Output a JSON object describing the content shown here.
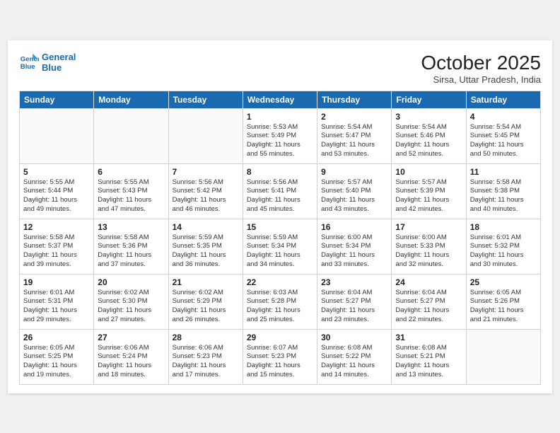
{
  "header": {
    "logo_line1": "General",
    "logo_line2": "Blue",
    "month_title": "October 2025",
    "location": "Sirsa, Uttar Pradesh, India"
  },
  "weekdays": [
    "Sunday",
    "Monday",
    "Tuesday",
    "Wednesday",
    "Thursday",
    "Friday",
    "Saturday"
  ],
  "weeks": [
    [
      {
        "day": "",
        "text": ""
      },
      {
        "day": "",
        "text": ""
      },
      {
        "day": "",
        "text": ""
      },
      {
        "day": "1",
        "text": "Sunrise: 5:53 AM\nSunset: 5:49 PM\nDaylight: 11 hours\nand 55 minutes."
      },
      {
        "day": "2",
        "text": "Sunrise: 5:54 AM\nSunset: 5:47 PM\nDaylight: 11 hours\nand 53 minutes."
      },
      {
        "day": "3",
        "text": "Sunrise: 5:54 AM\nSunset: 5:46 PM\nDaylight: 11 hours\nand 52 minutes."
      },
      {
        "day": "4",
        "text": "Sunrise: 5:54 AM\nSunset: 5:45 PM\nDaylight: 11 hours\nand 50 minutes."
      }
    ],
    [
      {
        "day": "5",
        "text": "Sunrise: 5:55 AM\nSunset: 5:44 PM\nDaylight: 11 hours\nand 49 minutes."
      },
      {
        "day": "6",
        "text": "Sunrise: 5:55 AM\nSunset: 5:43 PM\nDaylight: 11 hours\nand 47 minutes."
      },
      {
        "day": "7",
        "text": "Sunrise: 5:56 AM\nSunset: 5:42 PM\nDaylight: 11 hours\nand 46 minutes."
      },
      {
        "day": "8",
        "text": "Sunrise: 5:56 AM\nSunset: 5:41 PM\nDaylight: 11 hours\nand 45 minutes."
      },
      {
        "day": "9",
        "text": "Sunrise: 5:57 AM\nSunset: 5:40 PM\nDaylight: 11 hours\nand 43 minutes."
      },
      {
        "day": "10",
        "text": "Sunrise: 5:57 AM\nSunset: 5:39 PM\nDaylight: 11 hours\nand 42 minutes."
      },
      {
        "day": "11",
        "text": "Sunrise: 5:58 AM\nSunset: 5:38 PM\nDaylight: 11 hours\nand 40 minutes."
      }
    ],
    [
      {
        "day": "12",
        "text": "Sunrise: 5:58 AM\nSunset: 5:37 PM\nDaylight: 11 hours\nand 39 minutes."
      },
      {
        "day": "13",
        "text": "Sunrise: 5:58 AM\nSunset: 5:36 PM\nDaylight: 11 hours\nand 37 minutes."
      },
      {
        "day": "14",
        "text": "Sunrise: 5:59 AM\nSunset: 5:35 PM\nDaylight: 11 hours\nand 36 minutes."
      },
      {
        "day": "15",
        "text": "Sunrise: 5:59 AM\nSunset: 5:34 PM\nDaylight: 11 hours\nand 34 minutes."
      },
      {
        "day": "16",
        "text": "Sunrise: 6:00 AM\nSunset: 5:34 PM\nDaylight: 11 hours\nand 33 minutes."
      },
      {
        "day": "17",
        "text": "Sunrise: 6:00 AM\nSunset: 5:33 PM\nDaylight: 11 hours\nand 32 minutes."
      },
      {
        "day": "18",
        "text": "Sunrise: 6:01 AM\nSunset: 5:32 PM\nDaylight: 11 hours\nand 30 minutes."
      }
    ],
    [
      {
        "day": "19",
        "text": "Sunrise: 6:01 AM\nSunset: 5:31 PM\nDaylight: 11 hours\nand 29 minutes."
      },
      {
        "day": "20",
        "text": "Sunrise: 6:02 AM\nSunset: 5:30 PM\nDaylight: 11 hours\nand 27 minutes."
      },
      {
        "day": "21",
        "text": "Sunrise: 6:02 AM\nSunset: 5:29 PM\nDaylight: 11 hours\nand 26 minutes."
      },
      {
        "day": "22",
        "text": "Sunrise: 6:03 AM\nSunset: 5:28 PM\nDaylight: 11 hours\nand 25 minutes."
      },
      {
        "day": "23",
        "text": "Sunrise: 6:04 AM\nSunset: 5:27 PM\nDaylight: 11 hours\nand 23 minutes."
      },
      {
        "day": "24",
        "text": "Sunrise: 6:04 AM\nSunset: 5:27 PM\nDaylight: 11 hours\nand 22 minutes."
      },
      {
        "day": "25",
        "text": "Sunrise: 6:05 AM\nSunset: 5:26 PM\nDaylight: 11 hours\nand 21 minutes."
      }
    ],
    [
      {
        "day": "26",
        "text": "Sunrise: 6:05 AM\nSunset: 5:25 PM\nDaylight: 11 hours\nand 19 minutes."
      },
      {
        "day": "27",
        "text": "Sunrise: 6:06 AM\nSunset: 5:24 PM\nDaylight: 11 hours\nand 18 minutes."
      },
      {
        "day": "28",
        "text": "Sunrise: 6:06 AM\nSunset: 5:23 PM\nDaylight: 11 hours\nand 17 minutes."
      },
      {
        "day": "29",
        "text": "Sunrise: 6:07 AM\nSunset: 5:23 PM\nDaylight: 11 hours\nand 15 minutes."
      },
      {
        "day": "30",
        "text": "Sunrise: 6:08 AM\nSunset: 5:22 PM\nDaylight: 11 hours\nand 14 minutes."
      },
      {
        "day": "31",
        "text": "Sunrise: 6:08 AM\nSunset: 5:21 PM\nDaylight: 11 hours\nand 13 minutes."
      },
      {
        "day": "",
        "text": ""
      }
    ]
  ]
}
